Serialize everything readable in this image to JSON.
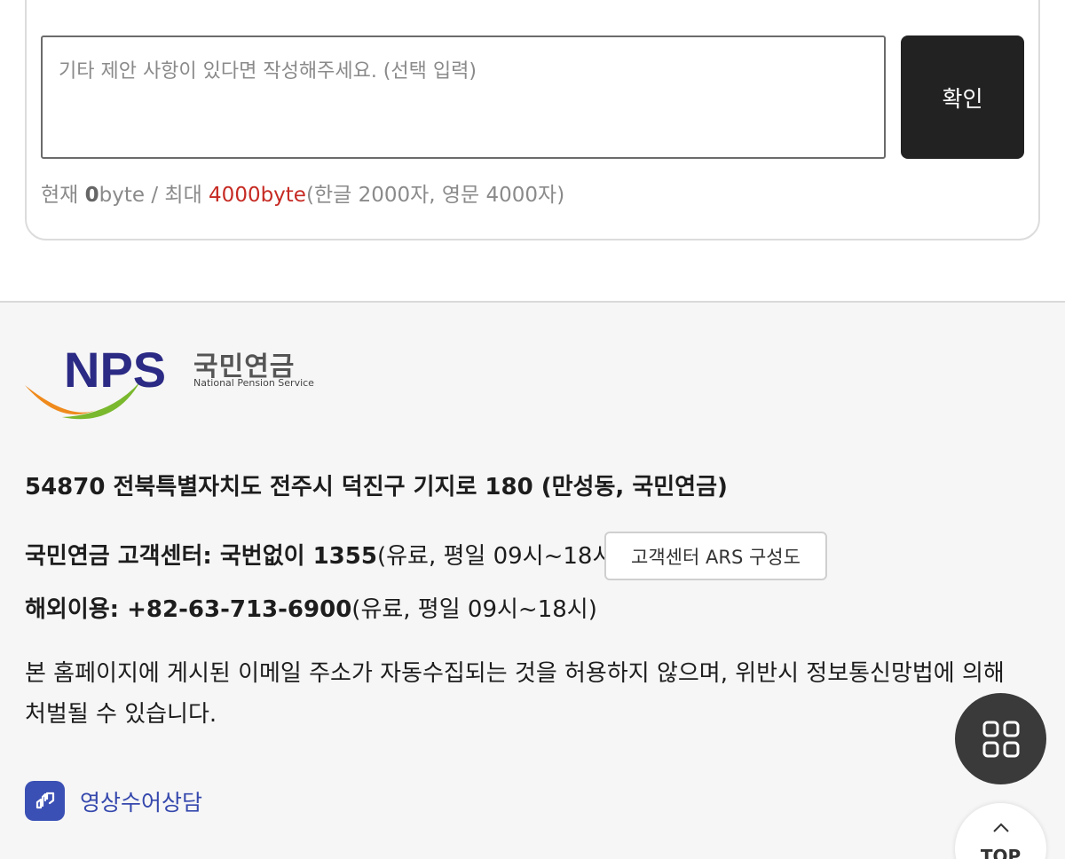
{
  "feedback": {
    "placeholder": "기타 제안 사항이 있다면 작성해주세요. (선택 입력)",
    "confirm_label": "확인",
    "byte_prefix": "현재 ",
    "byte_current": "0",
    "byte_mid": "byte / 최대 ",
    "byte_max": "4000byte",
    "byte_suffix": "(한글 2000자, 영문 4000자)"
  },
  "footer": {
    "logo": {
      "mark": "NPS",
      "name_ko": "국민연금",
      "name_en": "National Pension Service",
      "colors": {
        "navy": "#2b2a84",
        "orange": "#ef8a1c",
        "green": "#7ab82e"
      }
    },
    "address": "54870 전북특별자치도 전주시 덕진구 기지로 180 (만성동, 국민연금)",
    "call_center_label": "국민연금 고객센터: 국번없이 1355",
    "call_center_note": "(유료, 평일 09시~18시)",
    "ars_button": "고객센터 ARS 구성도",
    "overseas_label": "해외이용: +82-63-713-6900",
    "overseas_note": "(유료, 평일 09시~18시)",
    "notice": "본 홈페이지에 게시된 이메일 주소가 자동수집되는 것을 허용하지 않으며, 위반시 정보통신망법에 의해 처벌될 수 있습니다.",
    "sign_language_label": "영상수어상담"
  },
  "floating": {
    "menu_icon": "grid-icon",
    "top_label": "TOP"
  }
}
